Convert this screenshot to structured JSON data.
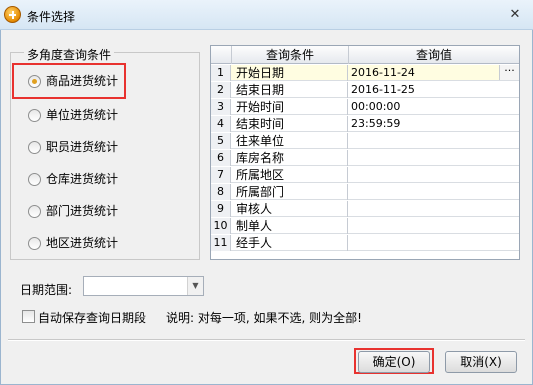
{
  "window": {
    "title": "条件选择",
    "close_label": "✕"
  },
  "group": {
    "legend": "多角度查询条件",
    "options": [
      {
        "label": "商品进货统计",
        "checked": true
      },
      {
        "label": "单位进货统计",
        "checked": false
      },
      {
        "label": "职员进货统计",
        "checked": false
      },
      {
        "label": "仓库进货统计",
        "checked": false
      },
      {
        "label": "部门进货统计",
        "checked": false
      },
      {
        "label": "地区进货统计",
        "checked": false
      }
    ]
  },
  "grid": {
    "headers": [
      "查询条件",
      "查询值"
    ],
    "rows": [
      {
        "num": "1",
        "cond": "开始日期",
        "value": "2016-11-24",
        "has_button": true
      },
      {
        "num": "2",
        "cond": "结束日期",
        "value": "2016-11-25"
      },
      {
        "num": "3",
        "cond": "开始时间",
        "value": "00:00:00"
      },
      {
        "num": "4",
        "cond": "结束时间",
        "value": "23:59:59"
      },
      {
        "num": "5",
        "cond": "往来单位",
        "value": ""
      },
      {
        "num": "6",
        "cond": "库房名称",
        "value": ""
      },
      {
        "num": "7",
        "cond": "所属地区",
        "value": ""
      },
      {
        "num": "8",
        "cond": "所属部门",
        "value": ""
      },
      {
        "num": "9",
        "cond": "审核人",
        "value": ""
      },
      {
        "num": "10",
        "cond": "制单人",
        "value": ""
      },
      {
        "num": "11",
        "cond": "经手人",
        "value": ""
      }
    ],
    "ellipsis_label": "···"
  },
  "date_range": {
    "label": "日期范围:",
    "value": ""
  },
  "autosave": {
    "label": "自动保存查询日期段",
    "checked": false
  },
  "hint": "说明: 对每一项, 如果不选, 则为全部!",
  "buttons": {
    "ok": "确定(O)",
    "cancel": "取消(X)"
  },
  "colors": {
    "highlight": "#e8322f",
    "radio_checked": "#e0a020"
  }
}
